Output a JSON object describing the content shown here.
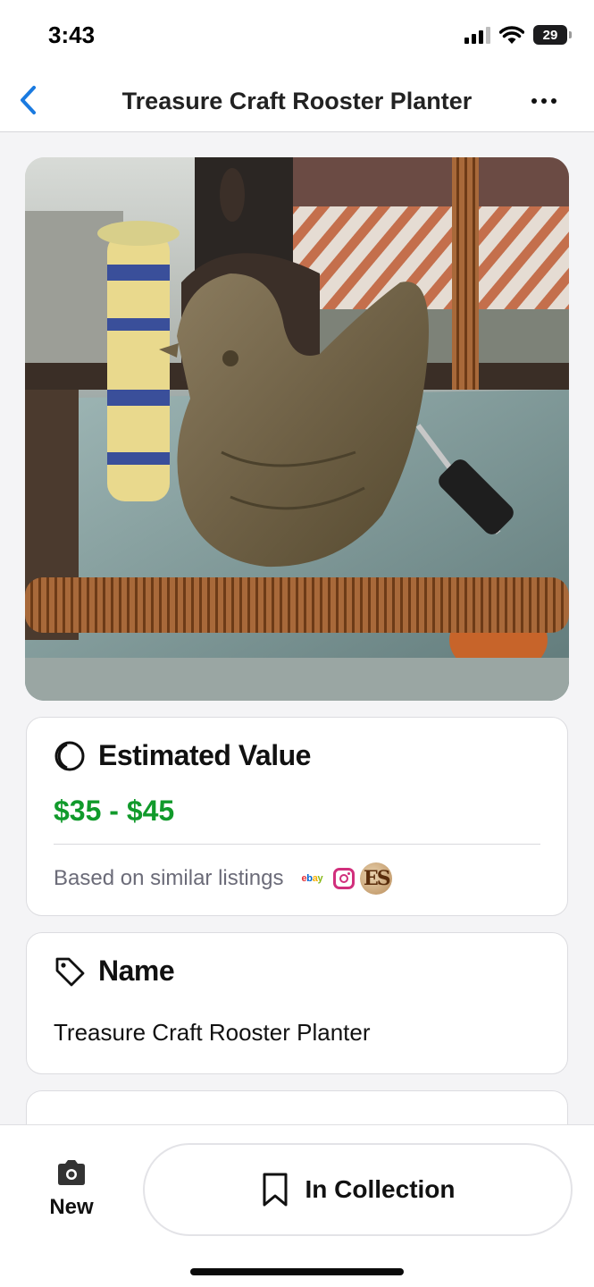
{
  "status_bar": {
    "time": "3:43",
    "battery": "29"
  },
  "nav": {
    "title": "Treasure Craft Rooster Planter",
    "back_icon": "chevron-left-icon",
    "more_icon": "ellipsis-icon"
  },
  "photo": {
    "subject": "rooster-planter-photo"
  },
  "value_card": {
    "heading": "Estimated Value",
    "icon": "moon-icon",
    "range": "$35 - $45",
    "source_text": "Based on similar listings",
    "sources": {
      "ebay": "ebay",
      "estate": "ES"
    },
    "accent": "#119a2b"
  },
  "name_card": {
    "heading": "Name",
    "icon": "tag-icon",
    "value": "Treasure Craft Rooster Planter"
  },
  "bottom_bar": {
    "new_label": "New",
    "new_icon": "camera-icon",
    "collection_label": "In Collection",
    "collection_icon": "bookmark-icon"
  },
  "colors": {
    "back_blue": "#1a7ae0",
    "price_green": "#119a2b"
  }
}
